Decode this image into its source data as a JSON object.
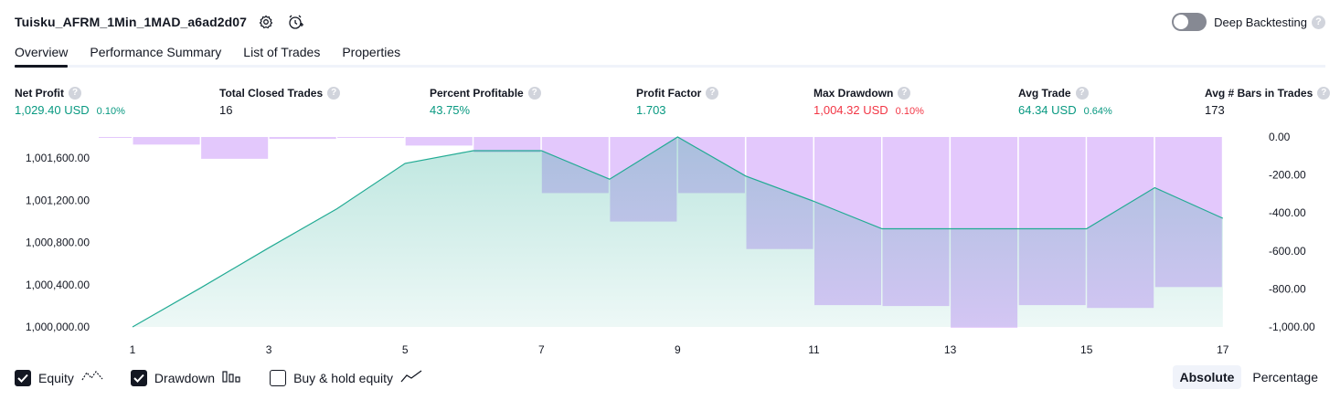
{
  "header": {
    "title": "Tuisku_AFRM_1Min_1MAD_a6ad2d07",
    "icons": [
      "settings-icon",
      "add-alert-icon"
    ],
    "deep_backtesting_label": "Deep Backtesting",
    "deep_backtesting_enabled": false,
    "help_glyph": "?"
  },
  "tabs": [
    {
      "label": "Overview",
      "active": true
    },
    {
      "label": "Performance Summary",
      "active": false
    },
    {
      "label": "List of Trades",
      "active": false
    },
    {
      "label": "Properties",
      "active": false
    }
  ],
  "metrics": {
    "net_profit": {
      "label": "Net Profit",
      "value": "1,029.40 USD",
      "pct": "0.10%"
    },
    "total_closed_trades": {
      "label": "Total Closed Trades",
      "value": "16"
    },
    "percent_profitable": {
      "label": "Percent Profitable",
      "value": "43.75%"
    },
    "profit_factor": {
      "label": "Profit Factor",
      "value": "1.703"
    },
    "max_drawdown": {
      "label": "Max Drawdown",
      "value": "1,004.32 USD",
      "pct": "0.10%"
    },
    "avg_trade": {
      "label": "Avg Trade",
      "value": "64.34 USD",
      "pct": "0.64%"
    },
    "avg_bars": {
      "label": "Avg # Bars in Trades",
      "value": "173"
    }
  },
  "colors": {
    "positive": "#089981",
    "negative": "#f23645",
    "equity_line": "#22ab94",
    "drawdown_bar": "#e1c5fc"
  },
  "chart_data": {
    "type": "area",
    "x": [
      1,
      2,
      3,
      4,
      5,
      6,
      7,
      8,
      9,
      10,
      11,
      12,
      13,
      14,
      15,
      16,
      17
    ],
    "x_ticks": [
      "1",
      "3",
      "5",
      "7",
      "9",
      "11",
      "13",
      "15",
      "17"
    ],
    "series": [
      {
        "axis": "left",
        "values": [
          1000000,
          1000370,
          1000750,
          1001120,
          1001550,
          1001670,
          1001670,
          1001400,
          1001800,
          1001430,
          1001190,
          1000930,
          1000930,
          1000930,
          1000930,
          1001320,
          1001030
        ]
      },
      {
        "axis": "right",
        "values": [
          -5,
          -40,
          -115,
          -10,
          -5,
          -45,
          -80,
          -295,
          -445,
          -295,
          -590,
          -885,
          -890,
          -1004.32,
          -885,
          -900,
          -790
        ]
      }
    ],
    "left_ticks": [
      "1,000,000.00",
      "1,000,400.00",
      "1,000,800.00",
      "1,001,200.00",
      "1,001,600.00"
    ],
    "right_ticks": [
      "0.00",
      "-200.00",
      "-400.00",
      "-600.00",
      "-800.00",
      "-1,000.00"
    ],
    "left_axis_range": [
      1000000,
      1001800
    ],
    "right_axis_range": [
      -1000,
      0
    ]
  },
  "footer": {
    "checkboxes": [
      {
        "label": "Equity",
        "checked": true,
        "icon": "equity-line-icon"
      },
      {
        "label": "Drawdown",
        "checked": true,
        "icon": "drawdown-bars-icon"
      },
      {
        "label": "Buy & hold equity",
        "checked": false,
        "icon": "buy-hold-line-icon"
      }
    ],
    "modes": [
      {
        "label": "Absolute",
        "active": true
      },
      {
        "label": "Percentage",
        "active": false
      }
    ]
  }
}
